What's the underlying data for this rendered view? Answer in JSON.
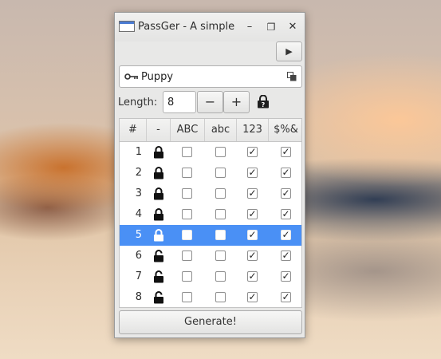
{
  "window": {
    "title": "PassGer - A simple pa",
    "minimize_glyph": "–",
    "restore_glyph": "❐",
    "close_glyph": "✕"
  },
  "toolbar": {
    "run_icon": "play-icon",
    "run_glyph": "▶"
  },
  "name_field": {
    "value": "Puppy",
    "key_icon": "key-icon",
    "copy_icon": "copy-icon"
  },
  "length": {
    "label": "Length:",
    "value": "8",
    "minus": "−",
    "plus": "+",
    "help_icon": "help-lock-icon"
  },
  "table": {
    "columns": [
      "#",
      "-",
      "ABC",
      "abc",
      "123",
      "$%&"
    ],
    "rows": [
      {
        "n": "1",
        "locked": true,
        "upper": false,
        "lower": false,
        "digits": true,
        "symbols": true,
        "selected": false
      },
      {
        "n": "2",
        "locked": true,
        "upper": false,
        "lower": false,
        "digits": true,
        "symbols": true,
        "selected": false
      },
      {
        "n": "3",
        "locked": true,
        "upper": false,
        "lower": false,
        "digits": true,
        "symbols": true,
        "selected": false
      },
      {
        "n": "4",
        "locked": true,
        "upper": false,
        "lower": false,
        "digits": true,
        "symbols": true,
        "selected": false
      },
      {
        "n": "5",
        "locked": true,
        "upper": false,
        "lower": false,
        "digits": true,
        "symbols": true,
        "selected": true
      },
      {
        "n": "6",
        "locked": false,
        "upper": false,
        "lower": false,
        "digits": true,
        "symbols": true,
        "selected": false
      },
      {
        "n": "7",
        "locked": false,
        "upper": false,
        "lower": false,
        "digits": true,
        "symbols": true,
        "selected": false
      },
      {
        "n": "8",
        "locked": false,
        "upper": false,
        "lower": false,
        "digits": true,
        "symbols": true,
        "selected": false
      }
    ]
  },
  "generate": {
    "label": "Generate!"
  },
  "colors": {
    "selection": "#4a90f5",
    "window_bg": "#e8e8e7"
  }
}
